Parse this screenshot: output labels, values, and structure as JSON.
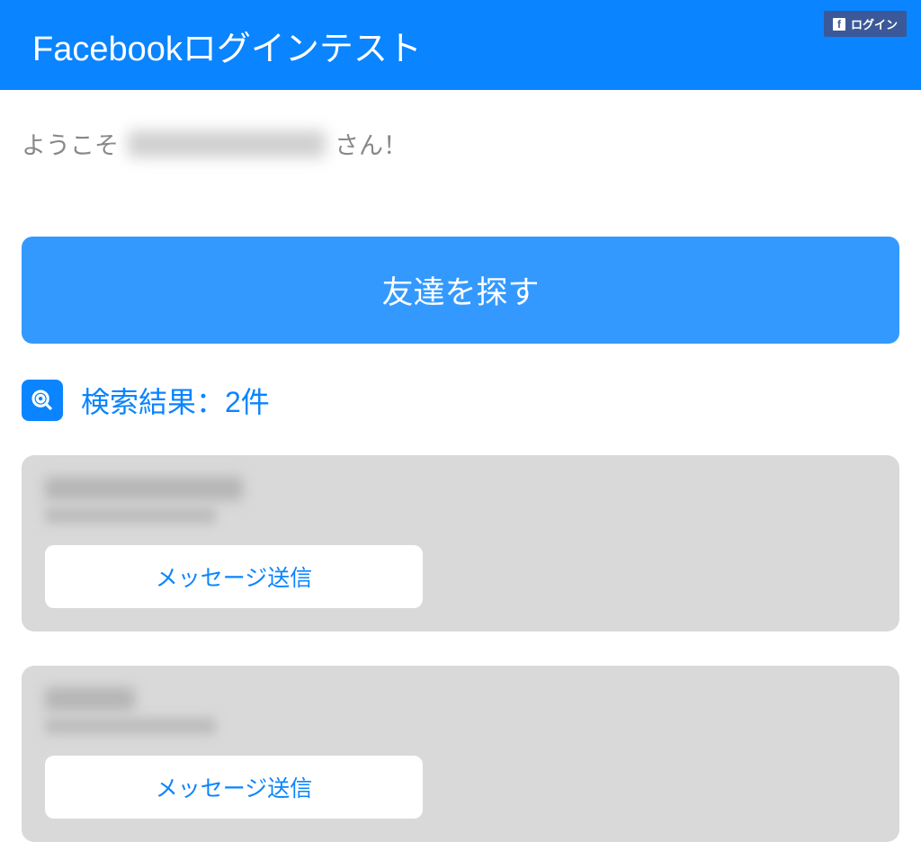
{
  "header": {
    "title": "Facebookログインテスト",
    "login_label": "ログイン"
  },
  "welcome": {
    "prefix": "ようこそ",
    "suffix": "さん！"
  },
  "find_friends_label": "友達を探す",
  "results": {
    "title": "検索結果：2件"
  },
  "items": [
    {
      "message_label": "メッセージ送信"
    },
    {
      "message_label": "メッセージ送信"
    }
  ]
}
